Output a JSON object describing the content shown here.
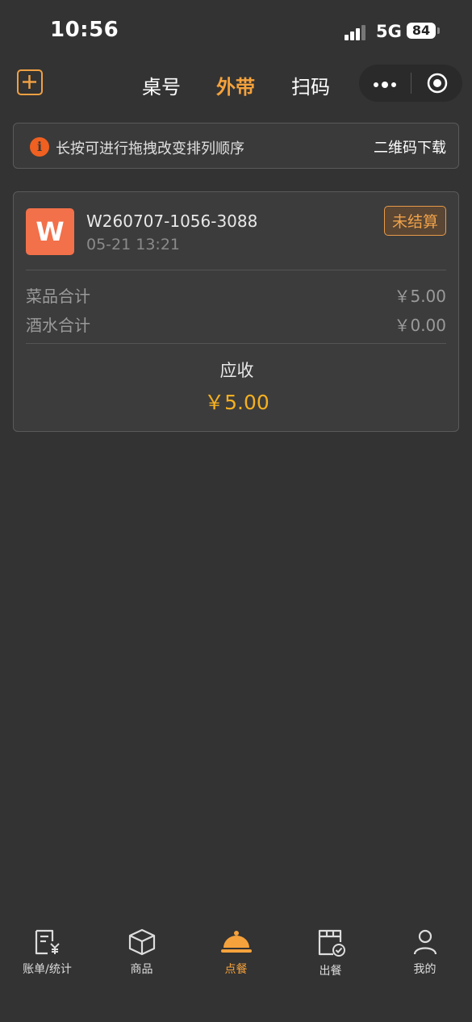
{
  "status_bar": {
    "time": "10:56",
    "network": "5G",
    "battery": "84"
  },
  "nav": {
    "tabs": [
      {
        "label": "桌号",
        "active": false
      },
      {
        "label": "外带",
        "active": true
      },
      {
        "label": "扫码",
        "active": false
      }
    ],
    "accent_color": "#f5a23c"
  },
  "notice": {
    "text": "长按可进行拖拽改变排列顺序",
    "action_label": "二维码下载",
    "icon": "info-icon"
  },
  "order": {
    "avatar_letter": "W",
    "order_no": "W260707-1056-3088",
    "time": "05-21 13:21",
    "status": "未结算",
    "dishes_label": "菜品合计",
    "dishes_value": "￥5.00",
    "drinks_label": "酒水合计",
    "drinks_value": "￥0.00",
    "due_label": "应收",
    "due_value": "￥5.00"
  },
  "tabbar": [
    {
      "label": "账单/统计",
      "icon": "bill-icon",
      "active": false
    },
    {
      "label": "商品",
      "icon": "box-icon",
      "active": false
    },
    {
      "label": "点餐",
      "icon": "cloche-icon",
      "active": true
    },
    {
      "label": "出餐",
      "icon": "serve-icon",
      "active": false
    },
    {
      "label": "我的",
      "icon": "user-icon",
      "active": false
    }
  ]
}
